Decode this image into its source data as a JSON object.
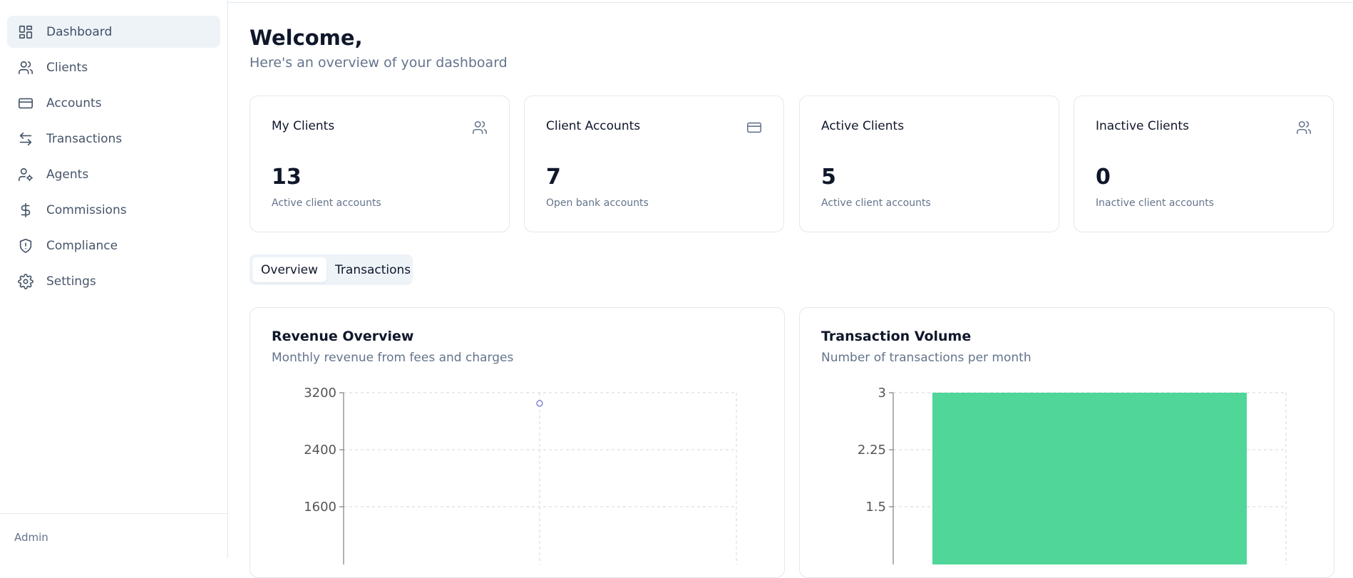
{
  "sidebar": {
    "items": [
      {
        "label": "Dashboard",
        "icon": "layout-dashboard-icon"
      },
      {
        "label": "Clients",
        "icon": "users-icon"
      },
      {
        "label": "Accounts",
        "icon": "credit-card-icon"
      },
      {
        "label": "Transactions",
        "icon": "arrow-left-right-icon"
      },
      {
        "label": "Agents",
        "icon": "user-cog-icon"
      },
      {
        "label": "Commissions",
        "icon": "dollar-sign-icon"
      },
      {
        "label": "Compliance",
        "icon": "shield-alert-icon"
      },
      {
        "label": "Settings",
        "icon": "settings-icon"
      }
    ],
    "active": "Dashboard",
    "footer": "Admin"
  },
  "header": {
    "title": "Welcome,",
    "subtitle": "Here's an overview of your dashboard"
  },
  "stats": [
    {
      "title": "My Clients",
      "value": "13",
      "description": "Active client accounts",
      "icon": "users-icon"
    },
    {
      "title": "Client Accounts",
      "value": "7",
      "description": "Open bank accounts",
      "icon": "credit-card-icon"
    },
    {
      "title": "Active Clients",
      "value": "5",
      "description": "Active client accounts",
      "icon": ""
    },
    {
      "title": "Inactive Clients",
      "value": "0",
      "description": "Inactive client accounts",
      "icon": "users-icon"
    }
  ],
  "tabs": [
    {
      "label": "Overview"
    },
    {
      "label": "Transactions"
    }
  ],
  "active_tab": "Overview",
  "colors": {
    "accent_bar": "#4fd698",
    "line_point": "#8884d8",
    "muted_text": "#64748b"
  },
  "chart_data": [
    {
      "type": "line",
      "title": "Revenue Overview",
      "subtitle": "Monthly revenue from fees and charges",
      "y_ticks": [
        "3200",
        "2400",
        "1600"
      ],
      "series": [
        {
          "values": [
            3050
          ]
        }
      ],
      "ylim": [
        0,
        3200
      ],
      "grid": true
    },
    {
      "type": "bar",
      "title": "Transaction Volume",
      "subtitle": "Number of transactions per month",
      "y_ticks": [
        "3",
        "2.25",
        "1.5"
      ],
      "series": [
        {
          "values": [
            3
          ]
        }
      ],
      "ylim": [
        0,
        3
      ],
      "grid": true
    }
  ]
}
